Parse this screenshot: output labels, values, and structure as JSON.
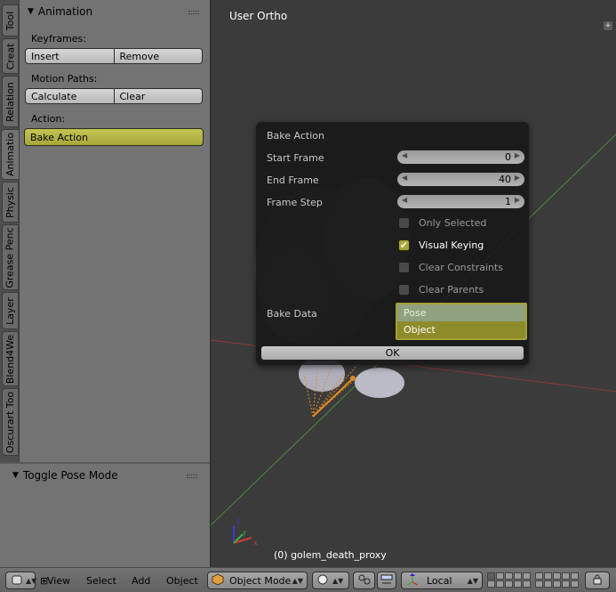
{
  "tool_panel": {
    "tabs": [
      "Tool",
      "Creat",
      "Relation",
      "Animatio",
      "Physic",
      "Grease Penc",
      "Layer",
      "Blend4We",
      "Oscurart Too"
    ],
    "active_tab": "Animatio",
    "panel_title": "Animation",
    "keyframes_label": "Keyframes:",
    "insert_label": "Insert",
    "remove_label": "Remove",
    "motion_paths_label": "Motion Paths:",
    "calculate_label": "Calculate",
    "clear_label": "Clear",
    "action_label": "Action:",
    "bake_action_label": "Bake Action",
    "toggle_pose_label": "Toggle Pose Mode"
  },
  "viewport": {
    "title": "User Ortho",
    "object_label": "(0) golem_death_proxy"
  },
  "dialog": {
    "title": "Bake Action",
    "start_frame_label": "Start Frame",
    "start_frame_value": "0",
    "end_frame_label": "End Frame",
    "end_frame_value": "40",
    "frame_step_label": "Frame Step",
    "frame_step_value": "1",
    "only_selected_label": "Only Selected",
    "only_selected": false,
    "visual_keying_label": "Visual Keying",
    "visual_keying": true,
    "clear_constraints_label": "Clear Constraints",
    "clear_constraints": false,
    "clear_parents_label": "Clear Parents",
    "clear_parents": false,
    "bake_data_label": "Bake Data",
    "bake_data_options": [
      "Pose",
      "Object"
    ],
    "bake_data_selected": "Object",
    "ok_label": "OK"
  },
  "bottom_bar": {
    "view_label": "View",
    "select_label": "Select",
    "add_label": "Add",
    "object_label": "Object",
    "mode_label": "Object Mode",
    "orientation_label": "Local"
  },
  "colors": {
    "accent": "#a6a634",
    "viewport_bg": "#3b3b3b",
    "panel_bg": "#737373"
  }
}
